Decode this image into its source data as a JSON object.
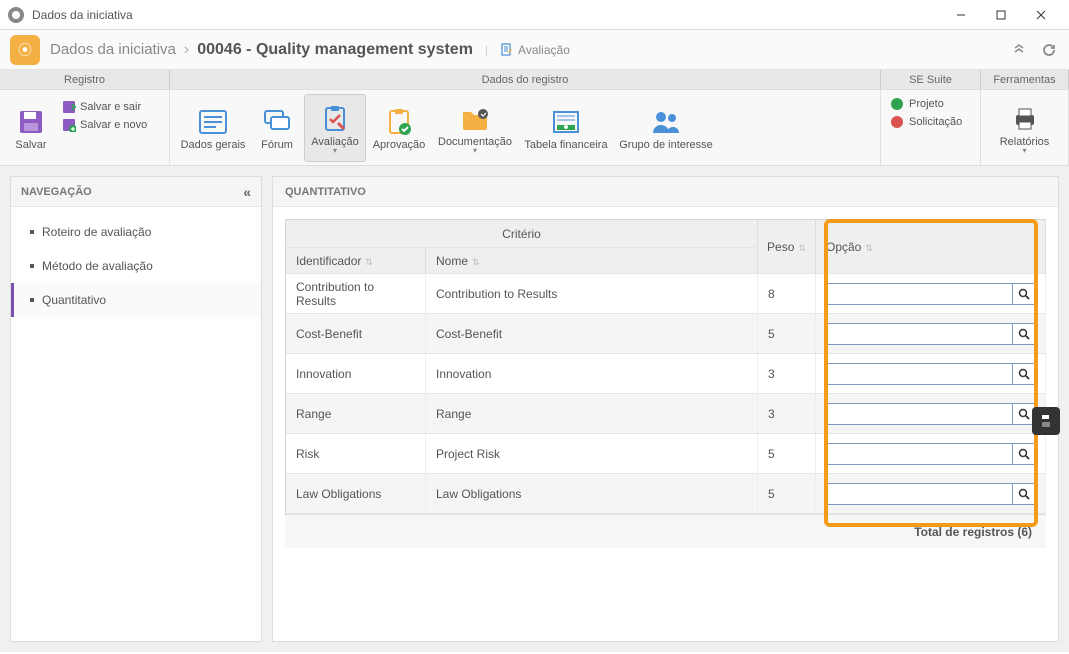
{
  "window": {
    "title": "Dados da iniciativa"
  },
  "breadcrumb": {
    "root": "Dados da iniciativa",
    "current": "00046 - Quality management system",
    "sub": "Avaliação"
  },
  "ribbon_tabs": {
    "registro": "Registro",
    "dados": "Dados do registro",
    "sesuite": "SE Suite",
    "ferramentas": "Ferramentas"
  },
  "ribbon": {
    "salvar": "Salvar",
    "salvar_sair": "Salvar e sair",
    "salvar_novo": "Salvar e novo",
    "dados_gerais": "Dados gerais",
    "forum": "Fórum",
    "avaliacao": "Avaliação",
    "aprovacao": "Aprovação",
    "documentacao": "Documentação",
    "tabela_financeira": "Tabela financeira",
    "grupo_interesse": "Grupo de interesse",
    "projeto": "Projeto",
    "solicitacao": "Solicitação",
    "relatorios": "Relatórios"
  },
  "nav": {
    "header": "NAVEGAÇÃO",
    "items": [
      {
        "label": "Roteiro de avaliação"
      },
      {
        "label": "Método de avaliação"
      },
      {
        "label": "Quantitativo"
      }
    ]
  },
  "content": {
    "header": "QUANTITATIVO",
    "table": {
      "group_header": "Critério",
      "col_identificador": "Identificador",
      "col_nome": "Nome",
      "col_peso": "Peso",
      "col_opcao": "Opção",
      "rows": [
        {
          "id": "Contribution to Results",
          "nome": "Contribution to Results",
          "peso": "8",
          "opcao": ""
        },
        {
          "id": "Cost-Benefit",
          "nome": "Cost-Benefit",
          "peso": "5",
          "opcao": ""
        },
        {
          "id": "Innovation",
          "nome": "Innovation",
          "peso": "3",
          "opcao": ""
        },
        {
          "id": "Range",
          "nome": "Range",
          "peso": "3",
          "opcao": ""
        },
        {
          "id": "Risk",
          "nome": "Project Risk",
          "peso": "5",
          "opcao": ""
        },
        {
          "id": "Law Obligations",
          "nome": "Law Obligations",
          "peso": "5",
          "opcao": ""
        }
      ],
      "footer": "Total de registros (6)"
    }
  }
}
